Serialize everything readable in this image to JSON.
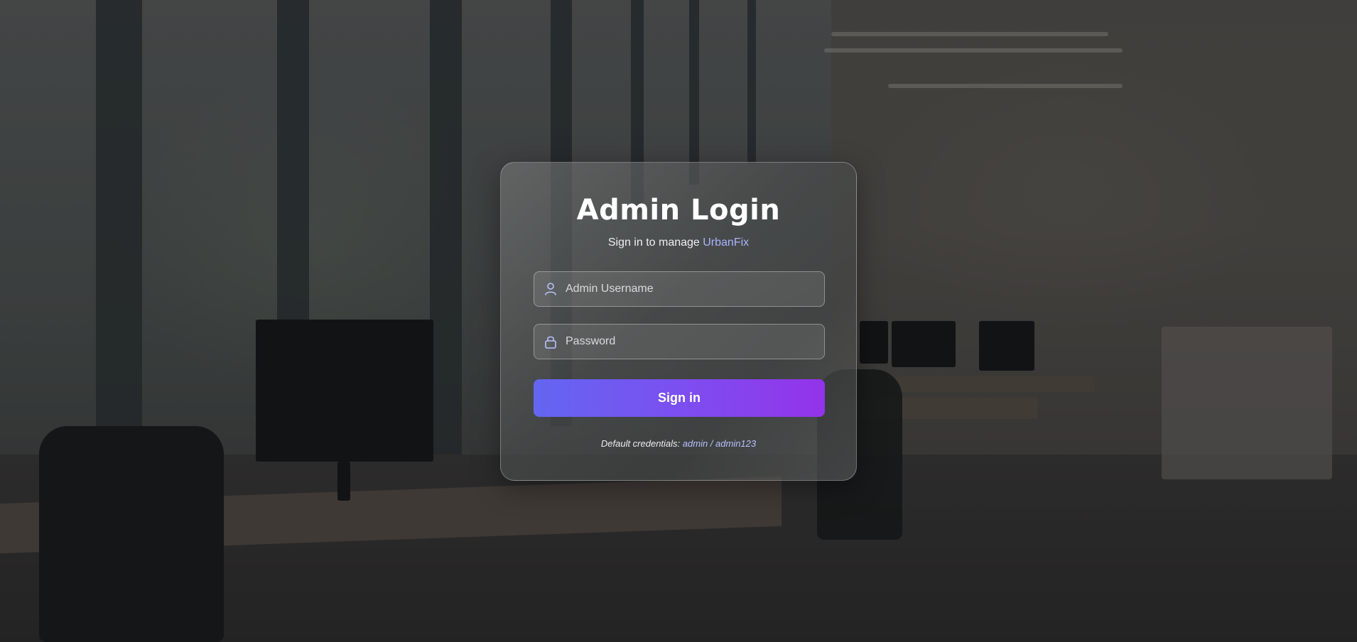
{
  "login": {
    "title": "Admin Login",
    "subtitle_prefix": "Sign in to manage ",
    "brand": "UrbanFix",
    "username_placeholder": "Admin Username",
    "username_icon": "user-icon",
    "password_placeholder": "Password",
    "password_icon": "lock-icon",
    "signin_label": "Sign in",
    "credentials_prefix": "Default credentials: ",
    "credentials_value": "admin / admin123"
  },
  "colors": {
    "brand_accent": "#a9b4ff",
    "button_gradient_start": "#6366f1",
    "button_gradient_end": "#9333ea",
    "icon": "#b9c2ff"
  }
}
